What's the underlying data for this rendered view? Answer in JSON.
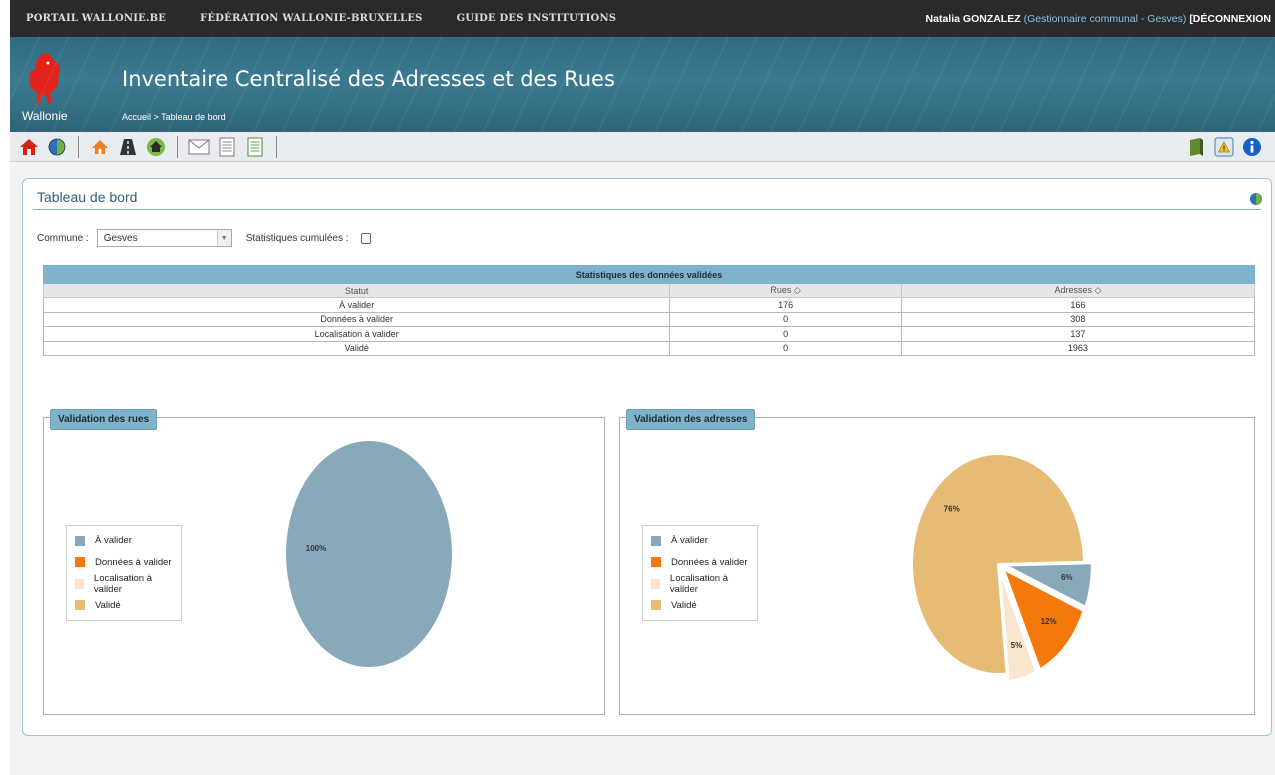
{
  "topnav": {
    "links": [
      "PORTAIL WALLONIE.BE",
      "FÉDÉRATION WALLONIE-BRUXELLES",
      "GUIDE DES INSTITUTIONS"
    ],
    "user_name": "Natalia GONZALEZ",
    "user_role": "(Gestionnaire communal - Gesves)",
    "logout_label": "[DÉCONNEXION"
  },
  "header": {
    "logo_label": "Wallonie",
    "title": "Inventaire Centralisé des Adresses et des Rues",
    "breadcrumb": "Accueil > Tableau de bord"
  },
  "toolbar": {
    "icons": [
      "home-icon",
      "globe-icon",
      "house-icon",
      "road-icon",
      "house-green-icon",
      "mail-icon",
      "document-icon",
      "document-green-icon",
      "book-icon",
      "warning-icon",
      "info-icon"
    ]
  },
  "colors": {
    "a_valider": "#88a9ba",
    "donnees_a_valider": "#f5780a",
    "localisation_a_valider": "#f8e6cf",
    "valide": "#e6bb74"
  },
  "page": {
    "title": "Tableau de bord",
    "commune_label": "Commune :",
    "commune_value": "Gesves",
    "cumul_label": "Statistiques cumulées :",
    "cumul_checked": false
  },
  "stats_table": {
    "caption": "Statistiques des données validées",
    "headers": [
      "Statut",
      "Rues ◇",
      "Adresses ◇"
    ],
    "rows": [
      [
        "À valider",
        "176",
        "166"
      ],
      [
        "Données à valider",
        "0",
        "308"
      ],
      [
        "Localisation à valider",
        "0",
        "137"
      ],
      [
        "Validé",
        "0",
        "1963"
      ]
    ]
  },
  "charts": {
    "rues_title": "Validation des rues",
    "adresses_title": "Validation des adresses",
    "legend": [
      "À valider",
      "Données à valider",
      "Localisation à valider",
      "Validé"
    ]
  },
  "chart_data": [
    {
      "type": "pie",
      "title": "Validation des rues",
      "categories": [
        "À valider",
        "Données à valider",
        "Localisation à valider",
        "Validé"
      ],
      "values": [
        176,
        0,
        0,
        0
      ],
      "slice_labels": [
        "100%",
        "",
        "",
        ""
      ],
      "legend_position": "left"
    },
    {
      "type": "pie",
      "title": "Validation des adresses",
      "categories": [
        "À valider",
        "Données à valider",
        "Localisation à valider",
        "Validé"
      ],
      "values": [
        166,
        308,
        137,
        1963
      ],
      "slice_labels": [
        "6%",
        "12%",
        "5%",
        "76%"
      ],
      "legend_position": "left"
    }
  ]
}
